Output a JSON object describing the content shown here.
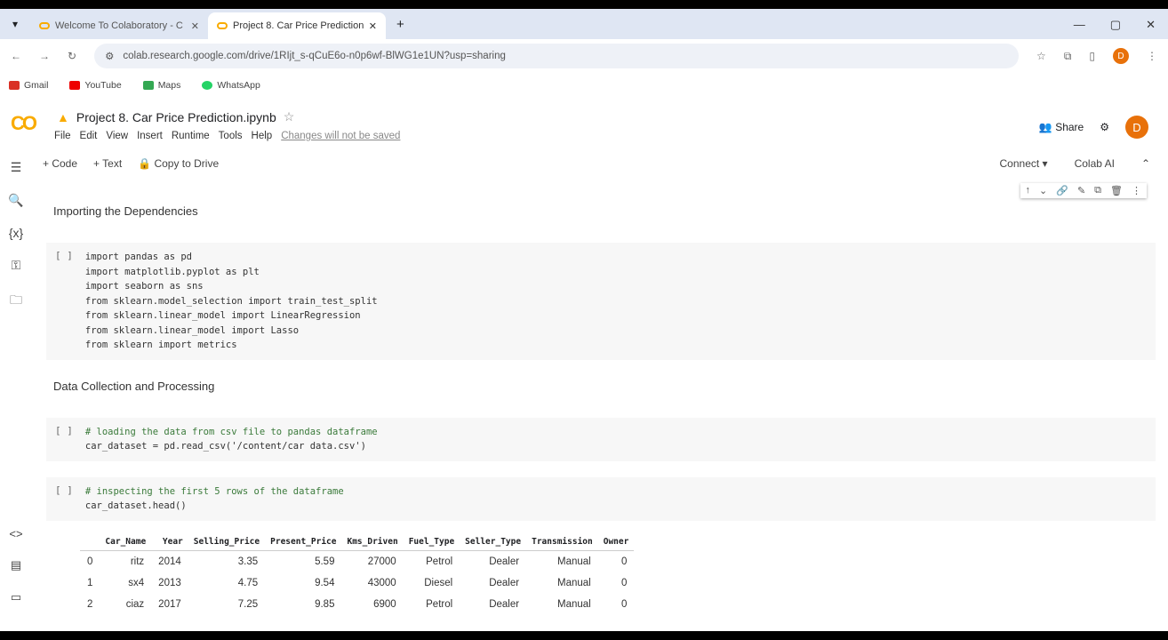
{
  "browser": {
    "tabs": [
      {
        "label": "Welcome To Colaboratory - C"
      },
      {
        "label": "Project 8. Car Price Prediction"
      }
    ],
    "url": "colab.research.google.com/drive/1RIjt_s-qCuE6o-n0p6wf-BlWG1e1UN?usp=sharing",
    "bookmarks": [
      "Gmail",
      "YouTube",
      "Maps",
      "WhatsApp"
    ]
  },
  "header": {
    "title": "Project 8. Car Price Prediction.ipynb",
    "menus": [
      "File",
      "Edit",
      "View",
      "Insert",
      "Runtime",
      "Tools",
      "Help"
    ],
    "warning": "Changes will not be saved",
    "share": "Share",
    "avatar": "D"
  },
  "toolbar": {
    "code": "+ Code",
    "text": "+ Text",
    "copy": "Copy to Drive",
    "connect": "Connect",
    "ai": "Colab AI"
  },
  "notebook": {
    "heading1": "Importing the Dependencies",
    "cell1": [
      "import pandas as pd",
      "import matplotlib.pyplot as plt",
      "import seaborn as sns",
      "from sklearn.model_selection import train_test_split",
      "from sklearn.linear_model import LinearRegression",
      "from sklearn.linear_model import Lasso",
      "from sklearn import metrics"
    ],
    "heading2": "Data Collection and Processing",
    "cell2": [
      "# loading the data from csv file to pandas dataframe",
      "car_dataset = pd.read_csv('/content/car data.csv')"
    ],
    "cell3": [
      "# inspecting the first 5 rows of the dataframe",
      "car_dataset.head()"
    ],
    "run_label": "[ ]",
    "table": {
      "columns": [
        "",
        "Car_Name",
        "Year",
        "Selling_Price",
        "Present_Price",
        "Kms_Driven",
        "Fuel_Type",
        "Seller_Type",
        "Transmission",
        "Owner"
      ],
      "rows": [
        [
          "0",
          "ritz",
          "2014",
          "3.35",
          "5.59",
          "27000",
          "Petrol",
          "Dealer",
          "Manual",
          "0"
        ],
        [
          "1",
          "sx4",
          "2013",
          "4.75",
          "9.54",
          "43000",
          "Diesel",
          "Dealer",
          "Manual",
          "0"
        ],
        [
          "2",
          "ciaz",
          "2017",
          "7.25",
          "9.85",
          "6900",
          "Petrol",
          "Dealer",
          "Manual",
          "0"
        ]
      ]
    }
  }
}
